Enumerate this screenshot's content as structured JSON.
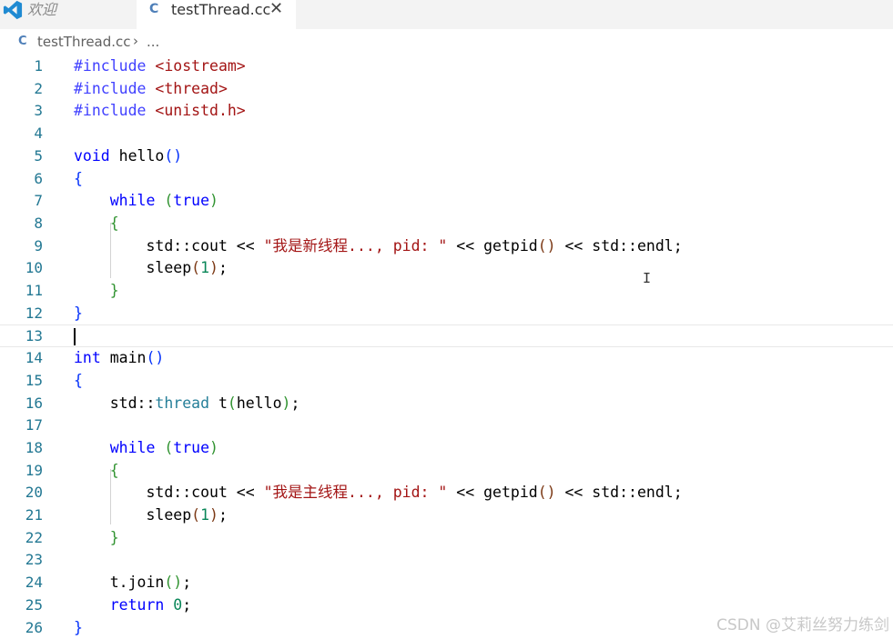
{
  "tabs": {
    "welcome_label": "欢迎",
    "active_label": "testThread.cc",
    "close_symbol": "✕",
    "file_icon_glyph": "C"
  },
  "breadcrumb": {
    "file": "testThread.cc",
    "separator": "›",
    "more": "..."
  },
  "editor": {
    "current_line": 13,
    "lines": [
      {
        "no": "1",
        "tokens": [
          [
            "pp",
            "#include "
          ],
          [
            "inc",
            "<iostream>"
          ]
        ]
      },
      {
        "no": "2",
        "tokens": [
          [
            "pp",
            "#include "
          ],
          [
            "inc",
            "<thread>"
          ]
        ]
      },
      {
        "no": "3",
        "tokens": [
          [
            "pp",
            "#include "
          ],
          [
            "inc",
            "<unistd.h>"
          ]
        ]
      },
      {
        "no": "4",
        "tokens": []
      },
      {
        "no": "5",
        "tokens": [
          [
            "k",
            "void"
          ],
          [
            "f",
            " hello"
          ],
          [
            "b1",
            "()"
          ]
        ]
      },
      {
        "no": "6",
        "tokens": [
          [
            "b1",
            "{"
          ]
        ]
      },
      {
        "no": "7",
        "tokens": [
          [
            "f",
            "    "
          ],
          [
            "k",
            "while"
          ],
          [
            "f",
            " "
          ],
          [
            "b2",
            "("
          ],
          [
            "k",
            "true"
          ],
          [
            "b2",
            ")"
          ]
        ]
      },
      {
        "no": "8",
        "tokens": [
          [
            "f",
            "    "
          ],
          [
            "b2",
            "{"
          ]
        ]
      },
      {
        "no": "9",
        "tokens": [
          [
            "f",
            "        std::cout << "
          ],
          [
            "s",
            "\"我是新线程..., pid: \""
          ],
          [
            "f",
            " << getpid"
          ],
          [
            "b3",
            "()"
          ],
          [
            "f",
            " << std::endl;"
          ]
        ]
      },
      {
        "no": "10",
        "tokens": [
          [
            "f",
            "        sleep"
          ],
          [
            "b3",
            "("
          ],
          [
            "n",
            "1"
          ],
          [
            "b3",
            ")"
          ],
          [
            "f",
            ";"
          ]
        ]
      },
      {
        "no": "11",
        "tokens": [
          [
            "f",
            "    "
          ],
          [
            "b2",
            "}"
          ]
        ]
      },
      {
        "no": "12",
        "tokens": [
          [
            "b1",
            "}"
          ]
        ]
      },
      {
        "no": "13",
        "tokens": []
      },
      {
        "no": "14",
        "tokens": [
          [
            "k",
            "int"
          ],
          [
            "f",
            " main"
          ],
          [
            "b1",
            "()"
          ]
        ]
      },
      {
        "no": "15",
        "tokens": [
          [
            "b1",
            "{"
          ]
        ]
      },
      {
        "no": "16",
        "tokens": [
          [
            "f",
            "    std::"
          ],
          [
            "t",
            "thread"
          ],
          [
            "f",
            " t"
          ],
          [
            "b2",
            "("
          ],
          [
            "f",
            "hello"
          ],
          [
            "b2",
            ")"
          ],
          [
            "f",
            ";"
          ]
        ]
      },
      {
        "no": "17",
        "tokens": []
      },
      {
        "no": "18",
        "tokens": [
          [
            "f",
            "    "
          ],
          [
            "k",
            "while"
          ],
          [
            "f",
            " "
          ],
          [
            "b2",
            "("
          ],
          [
            "k",
            "true"
          ],
          [
            "b2",
            ")"
          ]
        ]
      },
      {
        "no": "19",
        "tokens": [
          [
            "f",
            "    "
          ],
          [
            "b2",
            "{"
          ]
        ]
      },
      {
        "no": "20",
        "tokens": [
          [
            "f",
            "        std::cout << "
          ],
          [
            "s",
            "\"我是主线程..., pid: \""
          ],
          [
            "f",
            " << getpid"
          ],
          [
            "b3",
            "()"
          ],
          [
            "f",
            " << std::endl;"
          ]
        ]
      },
      {
        "no": "21",
        "tokens": [
          [
            "f",
            "        sleep"
          ],
          [
            "b3",
            "("
          ],
          [
            "n",
            "1"
          ],
          [
            "b3",
            ")"
          ],
          [
            "f",
            ";"
          ]
        ]
      },
      {
        "no": "22",
        "tokens": [
          [
            "f",
            "    "
          ],
          [
            "b2",
            "}"
          ]
        ]
      },
      {
        "no": "23",
        "tokens": []
      },
      {
        "no": "24",
        "tokens": [
          [
            "f",
            "    t.join"
          ],
          [
            "b2",
            "()"
          ],
          [
            "f",
            ";"
          ]
        ]
      },
      {
        "no": "25",
        "tokens": [
          [
            "f",
            "    "
          ],
          [
            "k",
            "return"
          ],
          [
            "f",
            " "
          ],
          [
            "n",
            "0"
          ],
          [
            "f",
            ";"
          ]
        ]
      },
      {
        "no": "26",
        "tokens": [
          [
            "b1",
            "}"
          ]
        ]
      }
    ]
  },
  "mouse_cursor_glyph": "I",
  "watermark": "CSDN @艾莉丝努力练剑",
  "colors": {
    "keyword": "#0000ff",
    "string": "#a31515",
    "number": "#098658",
    "type": "#267f99",
    "line_number": "#237893"
  }
}
